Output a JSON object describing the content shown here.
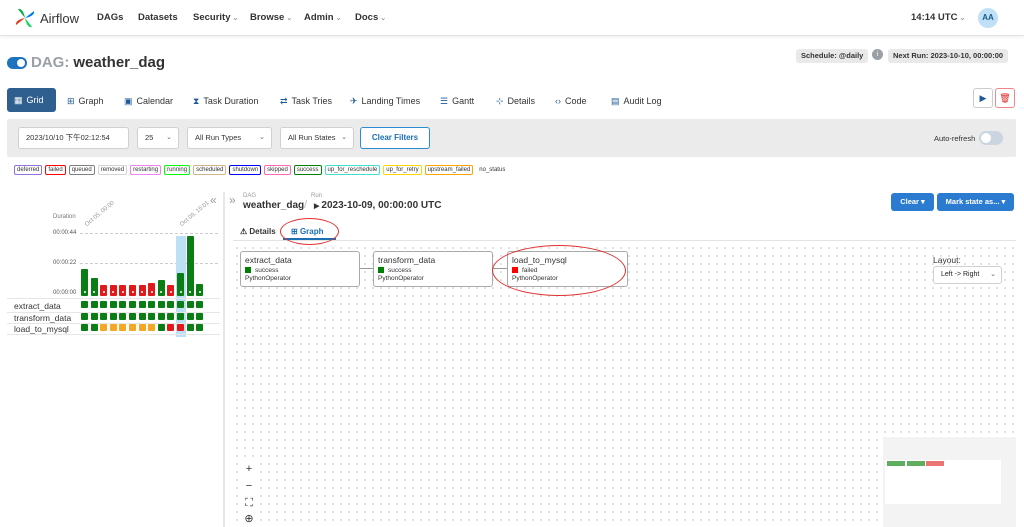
{
  "navbar": {
    "brand": "Airflow",
    "items": [
      {
        "label": "DAGs",
        "dropdown": false
      },
      {
        "label": "Datasets",
        "dropdown": false
      },
      {
        "label": "Security",
        "dropdown": true
      },
      {
        "label": "Browse",
        "dropdown": true
      },
      {
        "label": "Admin",
        "dropdown": true
      },
      {
        "label": "Docs",
        "dropdown": true
      }
    ],
    "time": "14:14 UTC",
    "avatar": "AA"
  },
  "dag": {
    "prefix": "DAG:",
    "name": "weather_dag",
    "schedule": "Schedule: @daily",
    "next_run": "Next Run: 2023-10-10, 00:00:00"
  },
  "tabs": [
    {
      "label": "Grid",
      "icon": "grid-icon"
    },
    {
      "label": "Graph",
      "icon": "graph-icon"
    },
    {
      "label": "Calendar",
      "icon": "calendar-icon"
    },
    {
      "label": "Task Duration",
      "icon": "hourglass-icon"
    },
    {
      "label": "Task Tries",
      "icon": "retry-icon"
    },
    {
      "label": "Landing Times",
      "icon": "landing-icon"
    },
    {
      "label": "Gantt",
      "icon": "gantt-icon"
    },
    {
      "label": "Details",
      "icon": "details-icon"
    },
    {
      "label": "Code",
      "icon": "code-icon"
    },
    {
      "label": "Audit Log",
      "icon": "document-icon"
    }
  ],
  "filters": {
    "date": "2023/10/10 下午02:12:54",
    "num_runs": "25",
    "run_types": "All Run Types",
    "run_states": "All Run States",
    "clear_label": "Clear Filters",
    "auto_refresh": "Auto-refresh"
  },
  "legend": [
    {
      "label": "deferred",
      "color": "#9370db"
    },
    {
      "label": "failed",
      "color": "#ff0000"
    },
    {
      "label": "queued",
      "color": "#808080"
    },
    {
      "label": "removed",
      "color": "#d3d3d3"
    },
    {
      "label": "restarting",
      "color": "#ee82ee"
    },
    {
      "label": "running",
      "color": "#00ff00"
    },
    {
      "label": "scheduled",
      "color": "#d2b48c"
    },
    {
      "label": "shutdown",
      "color": "#0000ff"
    },
    {
      "label": "skipped",
      "color": "#ff69b4"
    },
    {
      "label": "success",
      "color": "#008000"
    },
    {
      "label": "up_for_reschedule",
      "color": "#40e0d0"
    },
    {
      "label": "up_for_retry",
      "color": "#ffd700"
    },
    {
      "label": "upstream_failed",
      "color": "#ffa500"
    },
    {
      "label": "no_status",
      "color": "none"
    }
  ],
  "grid": {
    "duration_label": "Duration",
    "y_ticks": [
      "00:00:44",
      "00:00:22",
      "00:00:00"
    ],
    "date_labels": [
      "Oct 05, 00:00",
      "Oct 09, 15:01"
    ],
    "task_names": [
      "extract_data",
      "transform_data",
      "load_to_mysql"
    ],
    "duration_bars": [
      {
        "value": 0.45,
        "state": "success"
      },
      {
        "value": 0.3,
        "state": "success"
      },
      {
        "value": 0.18,
        "state": "failed"
      },
      {
        "value": 0.18,
        "state": "failed"
      },
      {
        "value": 0.18,
        "state": "failed"
      },
      {
        "value": 0.18,
        "state": "failed"
      },
      {
        "value": 0.18,
        "state": "failed"
      },
      {
        "value": 0.22,
        "state": "failed"
      },
      {
        "value": 0.27,
        "state": "success"
      },
      {
        "value": 0.18,
        "state": "failed"
      },
      {
        "value": 0.38,
        "state": "success"
      },
      {
        "value": 1.0,
        "state": "success"
      },
      {
        "value": 0.2,
        "state": "success"
      }
    ],
    "selected_column": 10,
    "cells": [
      [
        "success",
        "success",
        "success",
        "success",
        "success",
        "success",
        "success",
        "success",
        "success",
        "success",
        "success",
        "success",
        "success"
      ],
      [
        "success",
        "success",
        "success",
        "success",
        "success",
        "success",
        "success",
        "success",
        "success",
        "success",
        "success",
        "success",
        "success"
      ],
      [
        "success",
        "success",
        "upstream_failed",
        "upstream_failed",
        "upstream_failed",
        "upstream_failed",
        "upstream_failed",
        "upstream_failed",
        "success",
        "failed",
        "failed",
        "success",
        "success"
      ]
    ]
  },
  "run": {
    "dag_label": "DAG",
    "dag_name": "weather_dag",
    "run_label": "Run",
    "run_name": "2023-10-09, 00:00:00 UTC",
    "clear_label": "Clear",
    "mark_label": "Mark state as..."
  },
  "subtabs": {
    "details": "Details",
    "graph": "Graph"
  },
  "graph": {
    "nodes": [
      {
        "name": "extract_data",
        "state": "success",
        "operator": "PythonOperator",
        "color": "#008000"
      },
      {
        "name": "transform_data",
        "state": "success",
        "operator": "PythonOperator",
        "color": "#008000"
      },
      {
        "name": "load_to_mysql",
        "state": "failed",
        "operator": "PythonOperator",
        "color": "#ff0000"
      }
    ],
    "layout_label": "Layout:",
    "layout_value": "Left -> Right"
  },
  "colors": {
    "success": "#0a7d15",
    "failed": "#e01a1a",
    "upstream_failed": "#f5a623",
    "selected_col": "#bde0f5",
    "accent": "#2b7bd1"
  }
}
